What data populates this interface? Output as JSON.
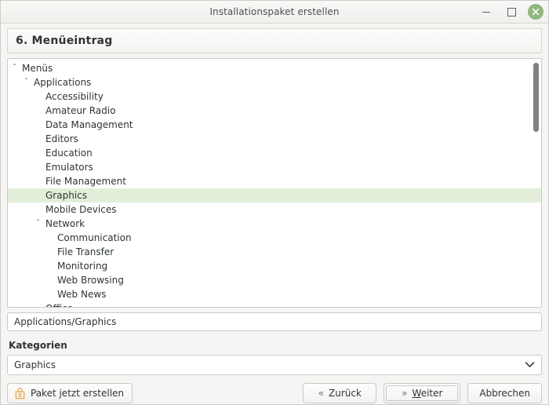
{
  "window": {
    "title": "Installationspaket erstellen",
    "buttons": {
      "minimize": "−",
      "maximize": "□",
      "close": "×"
    }
  },
  "step": {
    "title": "6. Menüeintrag"
  },
  "tree": {
    "rows": [
      {
        "label": "Menüs",
        "depth": 0,
        "expander": "chevron-down",
        "selected": false
      },
      {
        "label": "Applications",
        "depth": 1,
        "expander": "chevron-down",
        "selected": false
      },
      {
        "label": "Accessibility",
        "depth": 2,
        "expander": "none",
        "selected": false
      },
      {
        "label": "Amateur Radio",
        "depth": 2,
        "expander": "none",
        "selected": false
      },
      {
        "label": "Data Management",
        "depth": 2,
        "expander": "none",
        "selected": false
      },
      {
        "label": "Editors",
        "depth": 2,
        "expander": "none",
        "selected": false
      },
      {
        "label": "Education",
        "depth": 2,
        "expander": "none",
        "selected": false
      },
      {
        "label": "Emulators",
        "depth": 2,
        "expander": "none",
        "selected": false
      },
      {
        "label": "File Management",
        "depth": 2,
        "expander": "none",
        "selected": false
      },
      {
        "label": "Graphics",
        "depth": 2,
        "expander": "none",
        "selected": true
      },
      {
        "label": "Mobile Devices",
        "depth": 2,
        "expander": "none",
        "selected": false
      },
      {
        "label": "Network",
        "depth": 2,
        "expander": "chevron-down",
        "selected": false
      },
      {
        "label": "Communication",
        "depth": 3,
        "expander": "none",
        "selected": false
      },
      {
        "label": "File Transfer",
        "depth": 3,
        "expander": "none",
        "selected": false
      },
      {
        "label": "Monitoring",
        "depth": 3,
        "expander": "none",
        "selected": false
      },
      {
        "label": "Web Browsing",
        "depth": 3,
        "expander": "none",
        "selected": false
      },
      {
        "label": "Web News",
        "depth": 3,
        "expander": "none",
        "selected": false
      },
      {
        "label": "Office",
        "depth": 2,
        "expander": "none",
        "selected": false
      }
    ],
    "selected_color": "#e3eed9",
    "chevron_glyph": "ˇ"
  },
  "path_field": {
    "value": "Applications/Graphics"
  },
  "categories": {
    "label": "Kategorien",
    "selected": "Graphics",
    "arrow_glyph": "ˇ"
  },
  "actions": {
    "create_label": "Paket jetzt erstellen",
    "create_icon": "package-icon",
    "create_icon_color": "#e8a33d",
    "back_label": "Zurück",
    "back_arrow": "«",
    "next_label": "Weiter",
    "next_arrow": "»",
    "next_mnemonic": "W",
    "cancel_label": "Abbrechen"
  }
}
